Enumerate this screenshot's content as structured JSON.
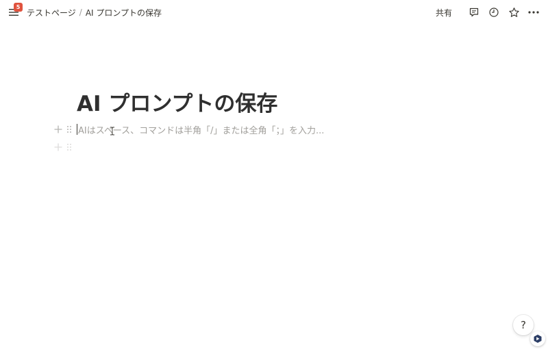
{
  "topbar": {
    "notification_count": "5",
    "breadcrumb": [
      {
        "label": "テストページ"
      },
      {
        "label": "AI プロンプトの保存"
      }
    ],
    "breadcrumb_separator": "/",
    "share_label": "共有",
    "icons": [
      "menu-icon",
      "comment-icon",
      "clock-icon",
      "star-icon",
      "more-icon"
    ]
  },
  "page": {
    "title": "AI プロンプトの保存",
    "blocks": [
      {
        "placeholder": "AIはスペース、コマンドは半角「/」または全角「；」を入力..."
      },
      {
        "placeholder": ""
      }
    ]
  },
  "bottom": {
    "help_label": "?",
    "extension_icon": "extension-icon"
  },
  "colors": {
    "text": "#37352f",
    "placeholder": "#a19f9b",
    "badge": "#e0533e",
    "extension": "#2c3e66"
  }
}
